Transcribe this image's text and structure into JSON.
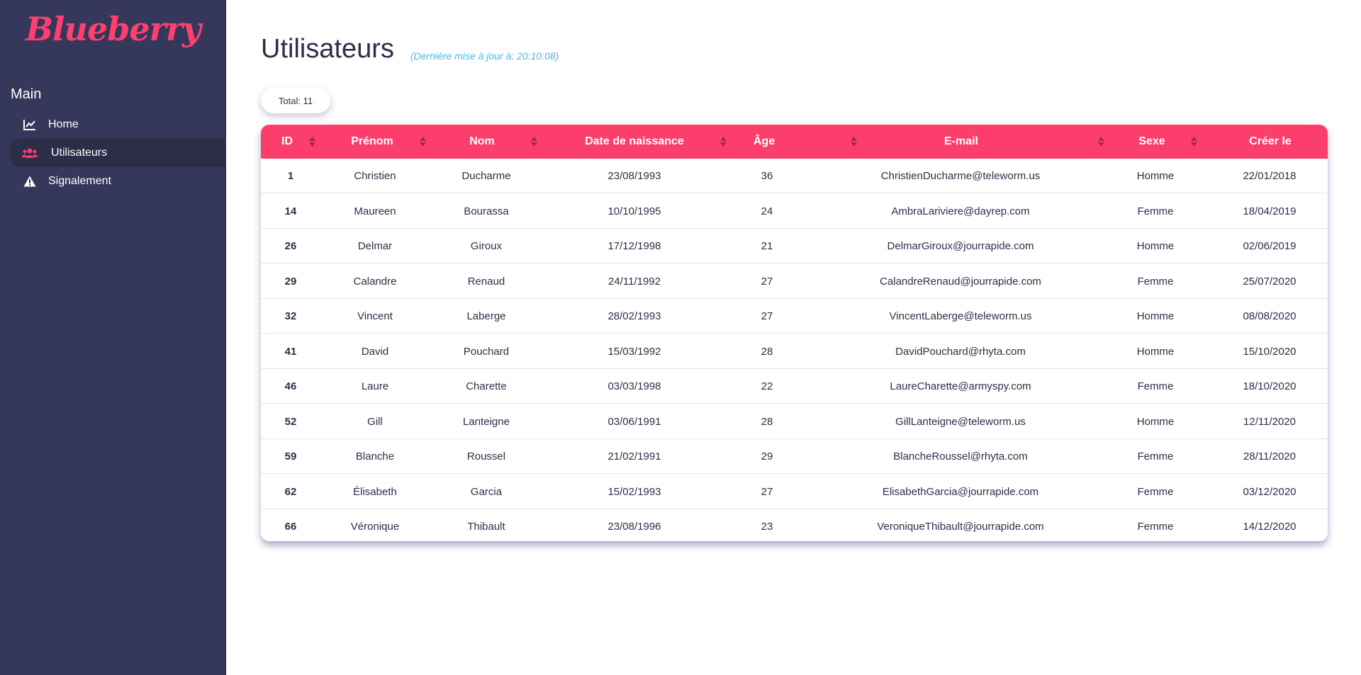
{
  "sidebar": {
    "logo": "Blueberry",
    "section_title": "Main",
    "items": [
      {
        "label": "Home",
        "icon": "chart-line-icon",
        "active": false
      },
      {
        "label": "Utilisateurs",
        "icon": "users-icon",
        "active": true
      },
      {
        "label": "Signalement",
        "icon": "warning-icon",
        "active": false
      }
    ]
  },
  "main": {
    "title": "Utilisateurs",
    "subtitle": "(Dernière mise à jour à: 20:10:08)",
    "total_label": "Total: 11"
  },
  "colors": {
    "accent": "#fc3e6c",
    "sidebar_bg": "#35385a",
    "subtitle": "#4fb4e8"
  },
  "table": {
    "columns": [
      "ID",
      "Prénom",
      "Nom",
      "Date de naissance",
      "Âge",
      "E-mail",
      "Sexe",
      "Créer le"
    ],
    "rows": [
      [
        "1",
        "Christien",
        "Ducharme",
        "23/08/1993",
        "36",
        "ChristienDucharme@teleworm.us",
        "Homme",
        "22/01/2018"
      ],
      [
        "14",
        "Maureen",
        "Bourassa",
        "10/10/1995",
        "24",
        "AmbraLariviere@dayrep.com",
        "Femme",
        "18/04/2019"
      ],
      [
        "26",
        "Delmar",
        "Giroux",
        "17/12/1998",
        "21",
        "DelmarGiroux@jourrapide.com",
        "Homme",
        "02/06/2019"
      ],
      [
        "29",
        "Calandre",
        "Renaud",
        "24/11/1992",
        "27",
        "CalandreRenaud@jourrapide.com",
        "Femme",
        "25/07/2020"
      ],
      [
        "32",
        "Vincent",
        "Laberge",
        "28/02/1993",
        "27",
        "VincentLaberge@teleworm.us",
        "Homme",
        "08/08/2020"
      ],
      [
        "41",
        "David",
        "Pouchard",
        "15/03/1992",
        "28",
        "DavidPouchard@rhyta.com",
        "Homme",
        "15/10/2020"
      ],
      [
        "46",
        "Laure",
        "Charette",
        "03/03/1998",
        "22",
        "LaureCharette@armyspy.com",
        "Femme",
        "18/10/2020"
      ],
      [
        "52",
        "Gill",
        "Lanteigne",
        "03/06/1991",
        "28",
        "GillLanteigne@teleworm.us",
        "Homme",
        "12/11/2020"
      ],
      [
        "59",
        "Blanche",
        "Roussel",
        "21/02/1991",
        "29",
        "BlancheRoussel@rhyta.com",
        "Femme",
        "28/11/2020"
      ],
      [
        "62",
        "Élisabeth",
        "Garcia",
        "15/02/1993",
        "27",
        "ElisabethGarcia@jourrapide.com",
        "Femme",
        "03/12/2020"
      ],
      [
        "66",
        "Véronique",
        "Thibault",
        "23/08/1996",
        "23",
        "VeroniqueThibault@jourrapide.com",
        "Femme",
        "14/12/2020"
      ]
    ]
  }
}
